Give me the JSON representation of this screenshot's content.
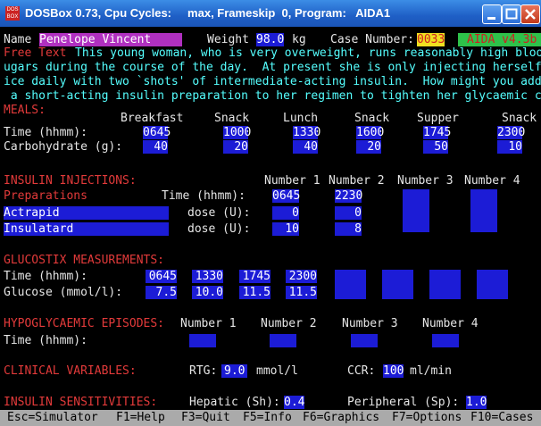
{
  "window": {
    "title": "DOSBox 0.73, Cpu Cycles:     max, Frameskip  0, Program:   AIDA1",
    "app_icon_text": "DOS BOX"
  },
  "header": {
    "name_label": "Name",
    "name_value": "Penelope Vincent",
    "weight_label": "Weight",
    "weight_value": "98.0",
    "weight_unit": "kg",
    "case_label": "Case Number:",
    "case_value": "0033",
    "version": "AIDA v4.3b"
  },
  "free_text": {
    "label": "Free Text",
    "line1": "This young woman, who is very overweight, runs reasonably high blood s",
    "line2": "ugars during the course of the day.  At present she is only injecting herself tw",
    "line3": "ice daily with two `shots' of intermediate-acting insulin.  How might you add in",
    "line4": " a short-acting insulin preparation to her regimen to tighten her glycaemic cont"
  },
  "meals": {
    "heading": "MEALS:",
    "columns": [
      "Breakfast",
      "Snack",
      "Lunch",
      "Snack",
      "Supper",
      "Snack"
    ],
    "time_label": "Time (hhmm):",
    "times": [
      "0645",
      "1000",
      "1330",
      "1600",
      "1745",
      "2300"
    ],
    "carb_label": "Carbohydrate (g):",
    "carbs": [
      "40",
      "20",
      "40",
      "20",
      "50",
      "10"
    ]
  },
  "insulin": {
    "heading": "INSULIN INJECTIONS:",
    "numbers": [
      "Number 1",
      "Number 2",
      "Number 3",
      "Number 4"
    ],
    "preparations_label": "Preparations",
    "time_label": "Time (hhmm):",
    "times": [
      "0645",
      "2230",
      "",
      ""
    ],
    "prep1": "Actrapid",
    "prep2": "Insulatard",
    "dose_label": "dose (U):",
    "dose1": [
      "0",
      "0",
      "",
      ""
    ],
    "dose2": [
      "10",
      "8",
      "",
      ""
    ]
  },
  "glucostix": {
    "heading": "GLUCOSTIX MEASUREMENTS:",
    "time_label": "Time (hhmm):",
    "times": [
      "0645",
      "1330",
      "1745",
      "2300"
    ],
    "glucose_label": "Glucose (mmol/l):",
    "glucose": [
      "7.5",
      "10.0",
      "11.5",
      "11.5"
    ]
  },
  "hypo": {
    "heading": "HYPOGLYCAEMIC EPISODES:",
    "numbers": [
      "Number 1",
      "Number 2",
      "Number 3",
      "Number 4"
    ],
    "time_label": "Time (hhmm):"
  },
  "clinical": {
    "heading": "CLINICAL VARIABLES:",
    "rtg_label": "RTG:",
    "rtg_value": "9.0",
    "rtg_unit": "mmol/l",
    "ccr_label": "CCR:",
    "ccr_value": "100",
    "ccr_unit": "ml/min"
  },
  "sensitivities": {
    "heading": "INSULIN SENSITIVITIES:",
    "hepatic_label": "Hepatic (Sh):",
    "hepatic_value": "0.4",
    "peripheral_label": "Peripheral (Sp):",
    "peripheral_value": "1.0"
  },
  "statusbar": {
    "keys": [
      "Esc=Simulator",
      "F1=Help",
      "F3=Quit",
      "F5=Info",
      "F6=Graphics",
      "F7=Options",
      "F10=Cases"
    ]
  },
  "colors": {
    "background": "#000000",
    "heading_red": "#e23a3a",
    "free_text_cyan": "#55ffff",
    "field_blue": "#1c1cd6",
    "case_yellow": "#f0e020",
    "version_green": "#2ec24a",
    "name_magenta": "#b030c0"
  }
}
